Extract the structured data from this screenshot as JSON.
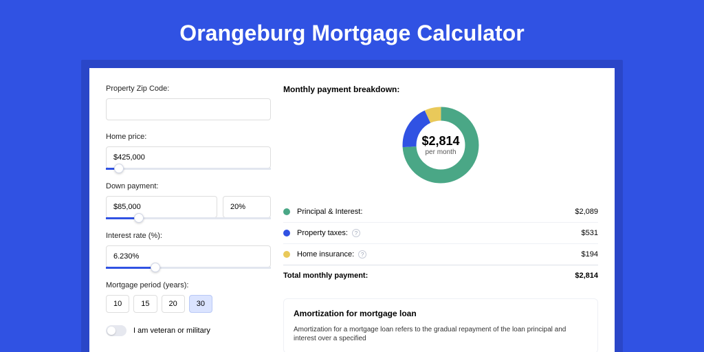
{
  "title": "Orangeburg Mortgage Calculator",
  "form": {
    "zip": {
      "label": "Property Zip Code:",
      "value": ""
    },
    "home_price": {
      "label": "Home price:",
      "value": "$425,000",
      "slider_pct": 8
    },
    "down_payment": {
      "label": "Down payment:",
      "amount": "$85,000",
      "percent": "20%",
      "slider_pct": 20
    },
    "interest": {
      "label": "Interest rate (%):",
      "value": "6.230%",
      "slider_pct": 30
    },
    "period": {
      "label": "Mortgage period (years):",
      "options": [
        "10",
        "15",
        "20",
        "30"
      ],
      "selected": "30"
    },
    "veteran_label": "I am veteran or military"
  },
  "breakdown": {
    "title": "Monthly payment breakdown:",
    "center_amount": "$2,814",
    "center_sub": "per month",
    "items": [
      {
        "name": "Principal & Interest:",
        "value": "$2,089",
        "color": "#4aa786",
        "pct": 74,
        "info": false
      },
      {
        "name": "Property taxes:",
        "value": "$531",
        "color": "#3052e3",
        "pct": 19,
        "info": true
      },
      {
        "name": "Home insurance:",
        "value": "$194",
        "color": "#e9c95a",
        "pct": 7,
        "info": true
      }
    ],
    "total_label": "Total monthly payment:",
    "total_value": "$2,814"
  },
  "amort": {
    "title": "Amortization for mortgage loan",
    "text": "Amortization for a mortgage loan refers to the gradual repayment of the loan principal and interest over a specified"
  },
  "chart_data": {
    "type": "pie",
    "title": "Monthly payment breakdown",
    "series": [
      {
        "name": "Principal & Interest",
        "value": 2089,
        "color": "#4aa786"
      },
      {
        "name": "Property taxes",
        "value": 531,
        "color": "#3052e3"
      },
      {
        "name": "Home insurance",
        "value": 194,
        "color": "#e9c95a"
      }
    ],
    "total": 2814,
    "center_label": "$2,814 per month"
  }
}
